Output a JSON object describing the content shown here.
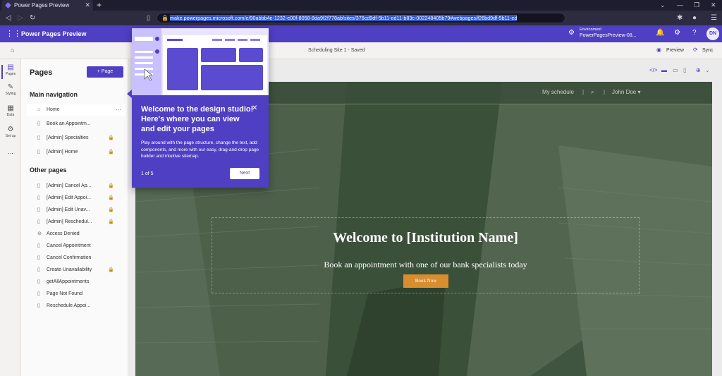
{
  "browser": {
    "tab_title": "Power Pages Preview",
    "url_host": "make.powerpages.microsoft.com",
    "url_rest": "/e/90abbb4e-1232-e00f-8058-8da9f2f778ab/sites/376cd9df-5b11-ed11-b83c-002248405b79#webpages/f26bd9df-5b11-ed"
  },
  "app": {
    "title": "Power Pages Preview",
    "env_label": "Environment",
    "env_name": "PowerPagesPreview-08...",
    "avatar_initials": "DN"
  },
  "toolbar": {
    "site_status": "Scheduling Site 1 - Saved",
    "preview_label": "Preview",
    "sync_label": "Sync"
  },
  "rail": {
    "items": [
      {
        "label": "Pages"
      },
      {
        "label": "Styling"
      },
      {
        "label": "Data"
      },
      {
        "label": "Set up"
      },
      {
        "label": "..."
      }
    ]
  },
  "pages_panel": {
    "title": "Pages",
    "add_label": "Page",
    "main_nav_heading": "Main navigation",
    "main_nav": [
      {
        "label": "Home",
        "selected": true
      },
      {
        "label": "Book an Appointm..."
      },
      {
        "label": "[Admin] Specialties",
        "locked": true
      },
      {
        "label": "[Admin] Home",
        "locked": true
      }
    ],
    "other_heading": "Other pages",
    "other_pages": [
      {
        "label": "[Admin] Cancel Ap...",
        "locked": true
      },
      {
        "label": "[Admin] Edit Appoi...",
        "locked": true
      },
      {
        "label": "[Admin] Edit Unav...",
        "locked": true
      },
      {
        "label": "[Admin] Reschedul...",
        "locked": true
      },
      {
        "label": "Access Denied"
      },
      {
        "label": "Cancel Appointment"
      },
      {
        "label": "Cancel Confirmation"
      },
      {
        "label": "Create Unavailability",
        "locked": true
      },
      {
        "label": "getAllAppointments"
      },
      {
        "label": "Page Not Found"
      },
      {
        "label": "Reschedule Appoi..."
      }
    ]
  },
  "site": {
    "nav_link": "My schedule",
    "nav_user": "John Doe ▾",
    "hero_title": "Welcome to [Institution Name]",
    "hero_subtitle": "Book an appointment with one of our bank specialists today",
    "cta": "Book Now"
  },
  "tour": {
    "title": "Welcome to the design studio! Here's where you can view and edit your pages",
    "body": "Play around with the page structure, change the text, add components, and more with our easy, drag-and-drop page builder and intuitive sitemap.",
    "step": "1 of 5",
    "next": "Next"
  }
}
